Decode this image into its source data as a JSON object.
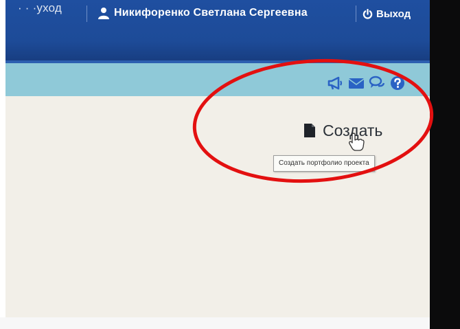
{
  "header": {
    "breadcrumb_fragment": "· · ·уход",
    "user_name": "Никифоренко Светлана Сергеевна",
    "logout_label": "Выход"
  },
  "toolbar": {
    "icons": [
      "megaphone-icon",
      "envelope-icon",
      "chat-icon",
      "help-icon"
    ]
  },
  "main": {
    "create_label": "Создать",
    "create_tooltip": "Создать портфолио проекта"
  },
  "colors": {
    "header_blue": "#1f4fa0",
    "subbar_teal": "#8fc9d8",
    "content_bg": "#f2efe8",
    "icon_blue": "#2a62c4",
    "annotation_red": "#e31010"
  }
}
